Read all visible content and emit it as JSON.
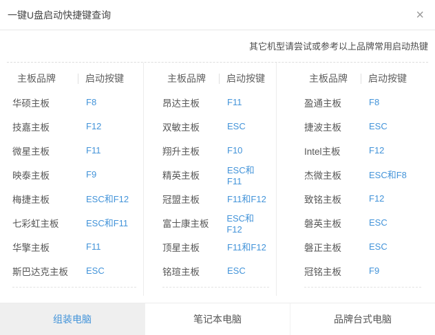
{
  "window": {
    "title": "一键U盘启动快捷键查询",
    "close_label": "×"
  },
  "hint": "其它机型请尝试或参考以上品牌常用启动热键",
  "table": {
    "brand_header": "主板品牌",
    "key_header": "启动按键",
    "columns": [
      {
        "rows": [
          {
            "brand": "华硕主板",
            "key": "F8"
          },
          {
            "brand": "技嘉主板",
            "key": "F12"
          },
          {
            "brand": "微星主板",
            "key": "F11"
          },
          {
            "brand": "映泰主板",
            "key": "F9"
          },
          {
            "brand": "梅捷主板",
            "key": "ESC和F12"
          },
          {
            "brand": "七彩虹主板",
            "key": "ESC和F11"
          },
          {
            "brand": "华擎主板",
            "key": "F11"
          },
          {
            "brand": "斯巴达克主板",
            "key": "ESC"
          }
        ]
      },
      {
        "rows": [
          {
            "brand": "昂达主板",
            "key": "F11"
          },
          {
            "brand": "双敏主板",
            "key": "ESC"
          },
          {
            "brand": "翔升主板",
            "key": "F10"
          },
          {
            "brand": "精英主板",
            "key": "ESC和F11"
          },
          {
            "brand": "冠盟主板",
            "key": "F11和F12"
          },
          {
            "brand": "富士康主板",
            "key": "ESC和F12"
          },
          {
            "brand": "顶星主板",
            "key": "F11和F12"
          },
          {
            "brand": "铭瑄主板",
            "key": "ESC"
          }
        ]
      },
      {
        "rows": [
          {
            "brand": "盈通主板",
            "key": "F8"
          },
          {
            "brand": "捷波主板",
            "key": "ESC"
          },
          {
            "brand": "Intel主板",
            "key": "F12"
          },
          {
            "brand": "杰微主板",
            "key": "ESC和F8"
          },
          {
            "brand": "致铭主板",
            "key": "F12"
          },
          {
            "brand": "磐英主板",
            "key": "ESC"
          },
          {
            "brand": "磐正主板",
            "key": "ESC"
          },
          {
            "brand": "冠铭主板",
            "key": "F9"
          }
        ]
      }
    ]
  },
  "tabs": [
    {
      "name": "assembled-pc",
      "label": "组装电脑",
      "active": true
    },
    {
      "name": "laptop",
      "label": "笔记本电脑",
      "active": false
    },
    {
      "name": "brand-desktop",
      "label": "品牌台式电脑",
      "active": false
    }
  ],
  "colors": {
    "accent_blue": "#4293d9",
    "active_tab_bg": "#efefef"
  }
}
